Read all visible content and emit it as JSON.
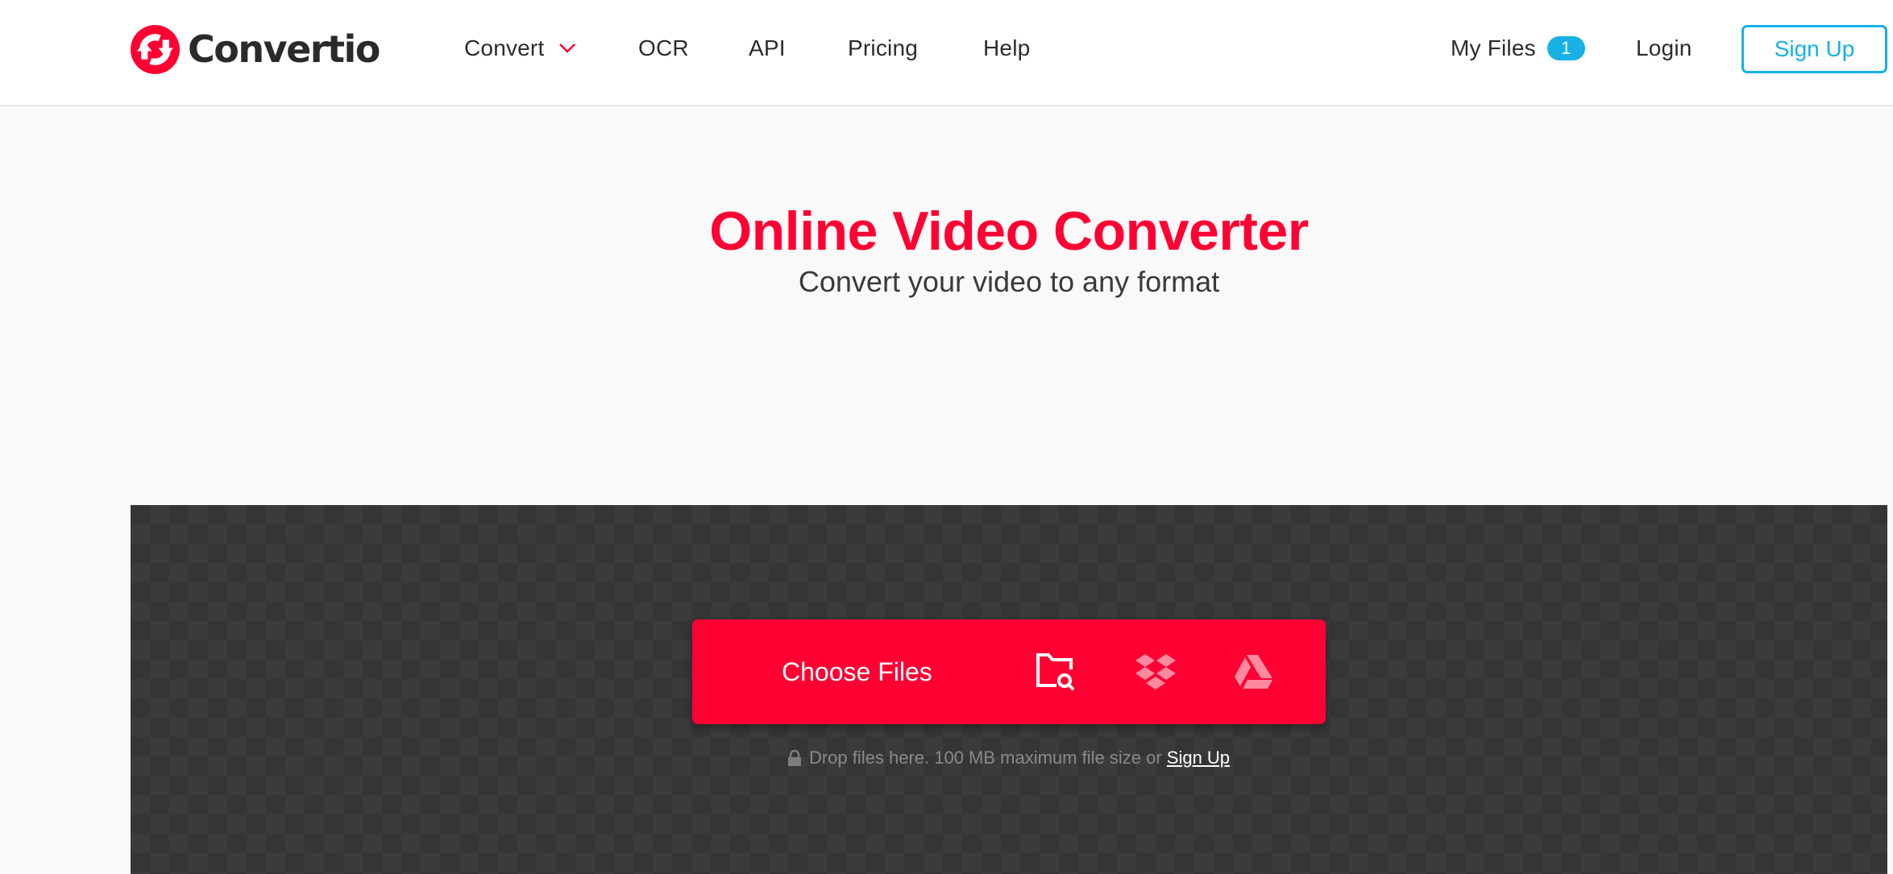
{
  "header": {
    "logo_text": "Convertio",
    "logo_icon": "convert-arrows-icon",
    "nav": [
      {
        "label": "Convert",
        "has_dropdown": true
      },
      {
        "label": "OCR"
      },
      {
        "label": "API"
      },
      {
        "label": "Pricing"
      },
      {
        "label": "Help"
      }
    ],
    "my_files_label": "My Files",
    "my_files_count": "1",
    "login_label": "Login",
    "signup_label": "Sign Up"
  },
  "hero": {
    "title": "Online Video Converter",
    "subtitle": "Convert your video to any format"
  },
  "upload": {
    "choose_files_label": "Choose Files",
    "sources": [
      {
        "name": "From Computer",
        "icon": "folder-search-icon"
      },
      {
        "name": "From Dropbox",
        "icon": "dropbox-icon"
      },
      {
        "name": "From Google Drive",
        "icon": "google-drive-icon"
      }
    ],
    "hint_text": "Drop files here. 100 MB maximum file size or ",
    "hint_link": "Sign Up"
  },
  "colors": {
    "brand_red": "#ff0033",
    "accent_blue": "#17b1e5",
    "dropzone_bg": "#353535",
    "page_bg": "#f9f9f9"
  }
}
